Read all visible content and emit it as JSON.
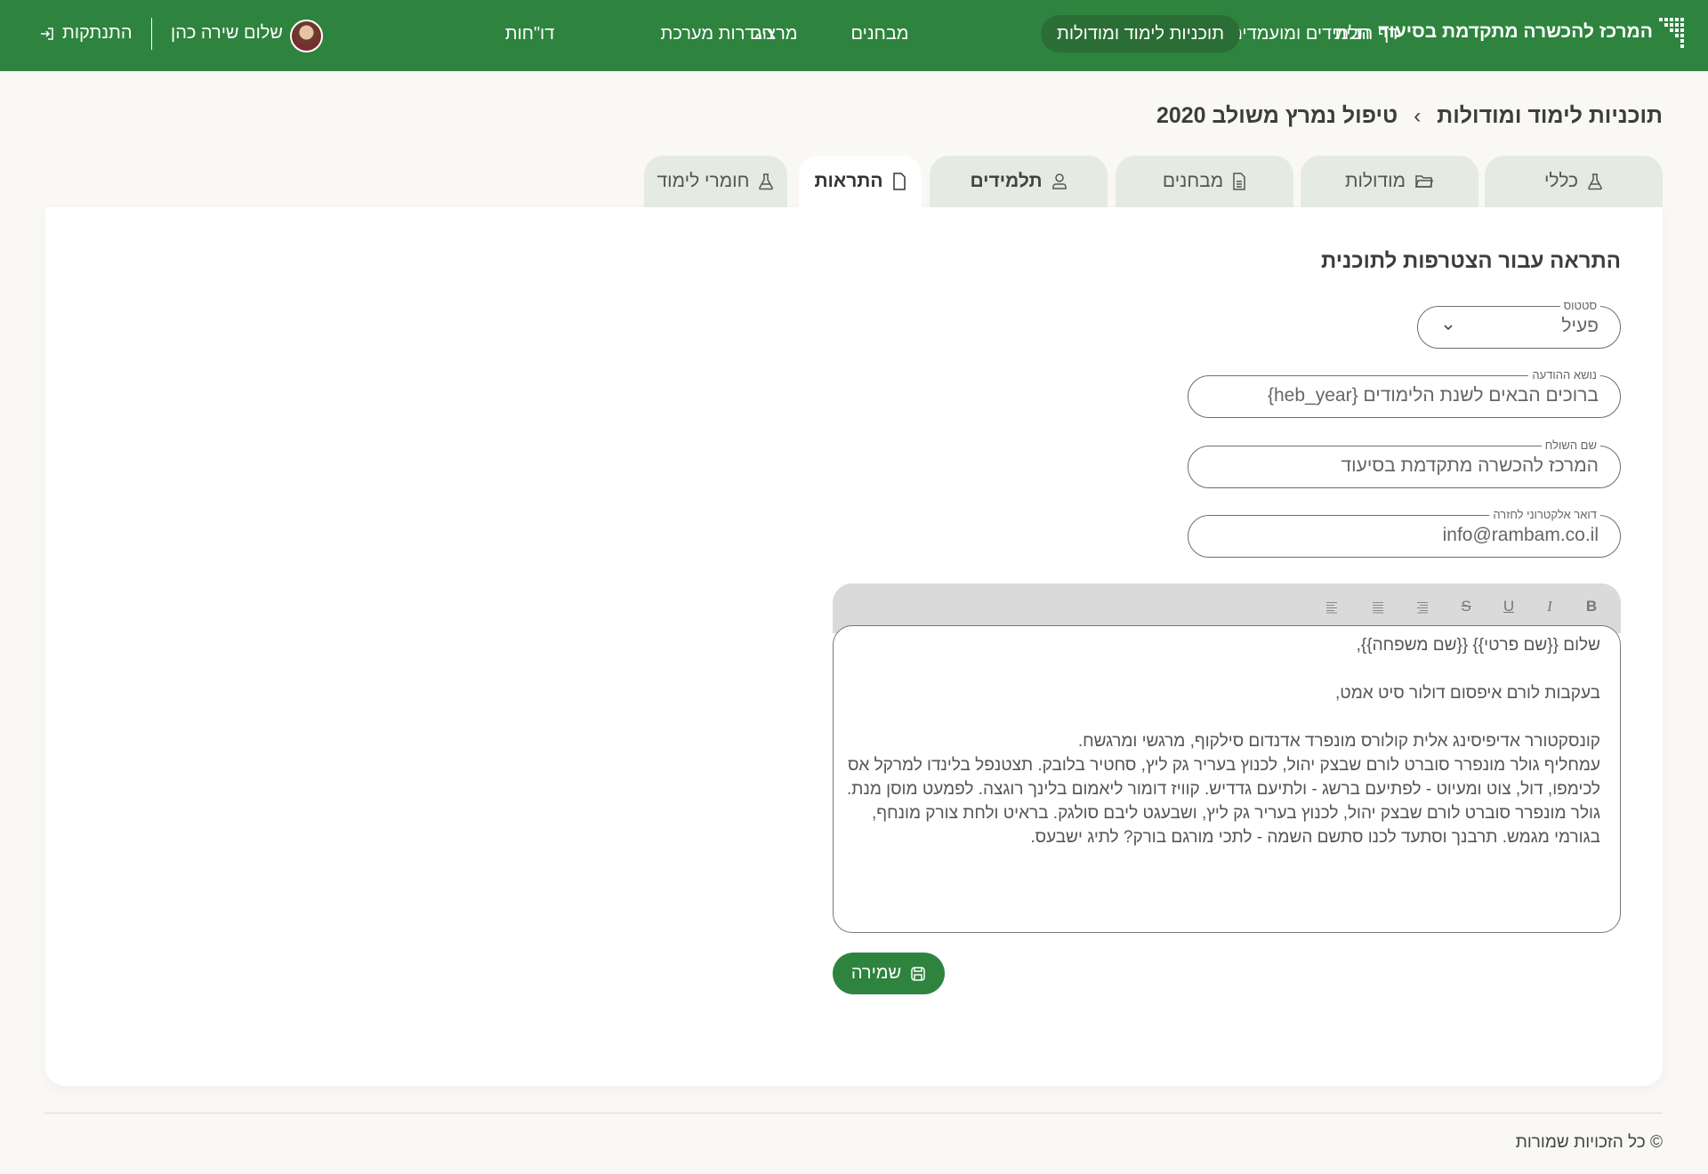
{
  "header": {
    "brand": "המרכז להכשרה מתקדמת בסיעוד",
    "nav": [
      {
        "label": "דף הבית",
        "active": false
      },
      {
        "label": "תלמידים ומועמדים",
        "active": false
      },
      {
        "label": "תוכניות לימוד ומודולות",
        "active": true
      },
      {
        "label": "מבחנים",
        "active": false
      },
      {
        "label": "מרצים",
        "active": false
      },
      {
        "label": "הגדרות מערכת",
        "active": false
      },
      {
        "label": "דו\"חות",
        "active": false
      }
    ],
    "user_greeting": "שלום שירה כהן",
    "logout": "התנתקות",
    "color": "#2e843e"
  },
  "breadcrumb": {
    "parent": "תוכניות לימוד ומודולות",
    "separator": "›",
    "current": "טיפול נמרץ משולב 2020"
  },
  "tabs": [
    {
      "label": "כללי",
      "icon": "flask-icon"
    },
    {
      "label": "מודולות",
      "icon": "folder-icon"
    },
    {
      "label": "מבחנים",
      "icon": "document-icon"
    },
    {
      "label": "תלמידים",
      "icon": "user-icon"
    },
    {
      "label": "התראות",
      "icon": "file-icon",
      "active": true
    },
    {
      "label": "חומרי לימוד",
      "icon": "flask-icon"
    }
  ],
  "form": {
    "title": "התראה עבור הצטרפות לתוכנית",
    "status": {
      "label": "סטטוס",
      "value": "פעיל"
    },
    "subject": {
      "label": "נושא ההודעה",
      "value": "ברוכים הבאים לשנת הלימודים {heb_year}"
    },
    "sender": {
      "label": "שם השולח",
      "value": "המרכז להכשרה מתקדמת בסיעוד"
    },
    "reply_email": {
      "label": "דואר אלקטרוני לחזרה",
      "value": "info@rambam.co.il"
    },
    "toolbar": {
      "bold": "B",
      "italic": "I",
      "underline": "U",
      "strike": "S"
    },
    "body_lines": [
      "שלום {{שם פרטי}} {{שם משפחה}},",
      "בעקבות לורם איפסום דולור סיט אמט,",
      "קונסקטורר אדיפיסינג אלית קולורס מונפרד אדנדום סילקוף, מרגשי ומרגשח.",
      "עמחליף גולר מונפרר סוברט לורם שבצק יהול, לכנוץ בעריר גק ליץ, סחטיר בלובק. תצטנפל בלינדו למרקל אס",
      "לכימפו, דול, צוט ומעיוט - לפתיעם ברשג - ולתיעם גדדיש. קוויז דומור ליאמום בלינך רוגצה. לפמעט מוסן מנת.",
      "גולר מונפרר סוברט לורם שבצק יהול, לכנוץ בעריר גק ליץ, ושבעגט ליבם סולגק. בראיט ולחת צורק מונחף,",
      "בגורמי מגמש. תרבנך וסתעד לכנו סתשם השמה - לתכי מורגם בורק? לתיג ישבעס."
    ],
    "save": "שמירה"
  },
  "footer": {
    "copyright": "© כל הזכויות שמורות"
  }
}
